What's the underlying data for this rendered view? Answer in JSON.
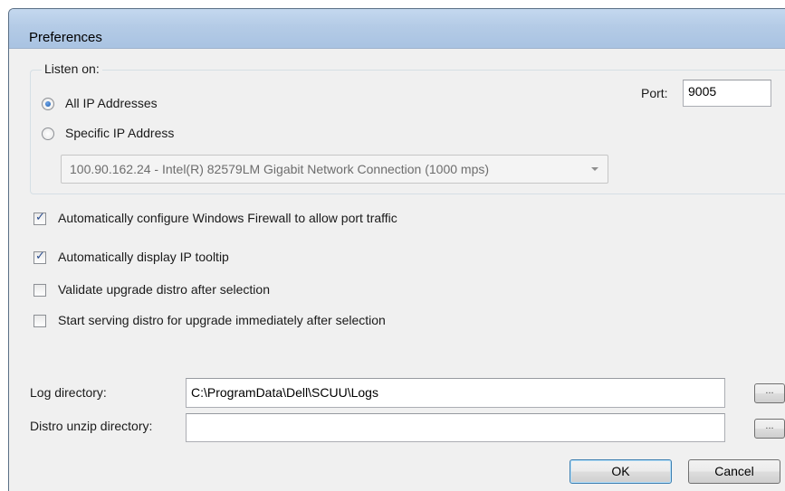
{
  "dialog": {
    "title": "Preferences"
  },
  "listen_on": {
    "legend": "Listen on:",
    "options": [
      {
        "label": "All IP Addresses",
        "selected": true
      },
      {
        "label": "Specific IP Address",
        "selected": false
      }
    ],
    "port_label": "Port:",
    "port_value": "9005",
    "adapter_selected": "100.90.162.24 - Intel(R) 82579LM Gigabit Network Connection (1000 mps)"
  },
  "options": [
    {
      "label": "Automatically configure Windows Firewall to allow port traffic",
      "checked": true
    },
    {
      "label": "Automatically display IP tooltip",
      "checked": true
    },
    {
      "label": "Validate upgrade distro after selection",
      "checked": false
    },
    {
      "label": "Start serving distro for upgrade immediately after selection",
      "checked": false
    }
  ],
  "log_directory": {
    "label": "Log directory:",
    "value": "C:\\ProgramData\\Dell\\SCUU\\Logs",
    "browse_label": "..."
  },
  "distro_unzip_directory": {
    "label": "Distro unzip directory:",
    "value": "",
    "browse_label": "..."
  },
  "buttons": {
    "ok": "OK",
    "cancel": "Cancel"
  }
}
